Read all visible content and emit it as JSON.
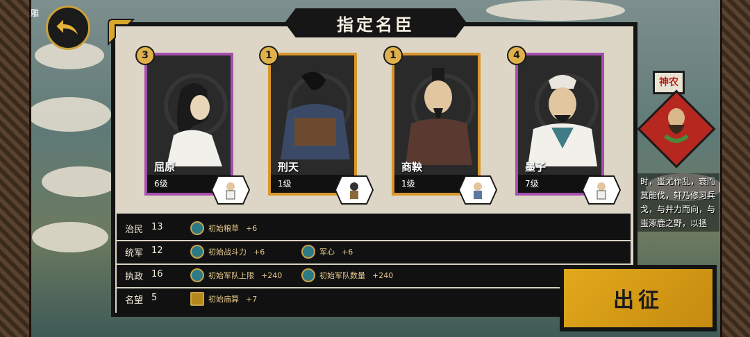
{
  "header": {
    "title": "指定名臣",
    "corner_label": "雕"
  },
  "back_button": {
    "icon": "back-arrow-icon"
  },
  "colors": {
    "gold": "#c9a23a",
    "purple": "#a64fb0",
    "orange": "#d9962a",
    "accent_button": "#e2a91c"
  },
  "cards": [
    {
      "name": "屈原",
      "level": "6级",
      "badge": "3",
      "frame": "#a64fb0"
    },
    {
      "name": "刑天",
      "level": "1级",
      "badge": "1",
      "frame": "#d9962a"
    },
    {
      "name": "商鞅",
      "level": "1级",
      "badge": "1",
      "frame": "#d9962a"
    },
    {
      "name": "墨子",
      "level": "7级",
      "badge": "4",
      "frame": "#a64fb0"
    }
  ],
  "stats": [
    {
      "attr": "治民",
      "value": "13",
      "bonuses": [
        {
          "icon": "grain-icon",
          "name": "初始粮草",
          "value": "+6"
        }
      ]
    },
    {
      "attr": "统军",
      "value": "12",
      "bonuses": [
        {
          "icon": "fist-icon",
          "name": "初始战斗力",
          "value": "+6"
        },
        {
          "icon": "soldier-icon",
          "name": "军心",
          "value": "+6"
        }
      ]
    },
    {
      "attr": "执政",
      "value": "16",
      "bonuses": [
        {
          "icon": "soldier-icon",
          "name": "初始军队上限",
          "value": "+240"
        },
        {
          "icon": "soldier-icon",
          "name": "初始军队数量",
          "value": "+240"
        }
      ]
    },
    {
      "attr": "名望",
      "value": "5",
      "bonuses": [
        {
          "icon": "temple-icon",
          "name": "初始庙算",
          "value": "+7"
        }
      ]
    }
  ],
  "sidebar": {
    "flag": "神农",
    "lore": "时，蚩尤作乱，衰而莫能伐，轩乃修习兵戈，与井力而向，与蚩涿鹿之野，以拯"
  },
  "go_button": {
    "label": "出征"
  }
}
